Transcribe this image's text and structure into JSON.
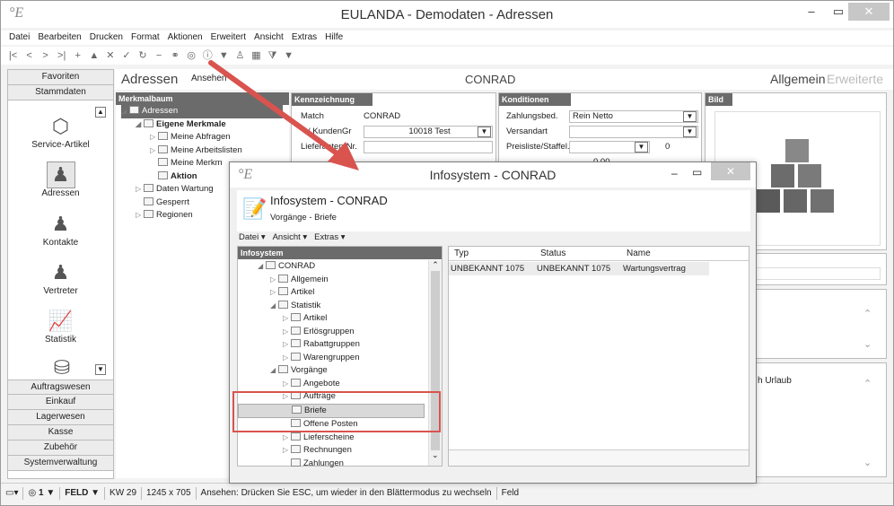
{
  "app": {
    "logo": "°E",
    "title": "EULANDA - Demodaten - Adressen",
    "minimize": "–",
    "maximize": "▭",
    "close": "✕"
  },
  "menu": [
    "Datei",
    "Bearbeiten",
    "Drucken",
    "Format",
    "Aktionen",
    "Erweitert",
    "Ansicht",
    "Extras",
    "Hilfe"
  ],
  "sidebar": {
    "top_tabs": [
      "Favoriten",
      "Stammdaten"
    ],
    "items": [
      {
        "label": "Service-Artikel",
        "icon": "cube-icon"
      },
      {
        "label": "Adressen",
        "icon": "person-icon"
      },
      {
        "label": "Kontakte",
        "icon": "contact-icon"
      },
      {
        "label": "Vertreter",
        "icon": "rep-icon"
      },
      {
        "label": "Statistik",
        "icon": "chart-icon"
      }
    ],
    "bottom_tabs": [
      "Auftragswesen",
      "Einkauf",
      "Lagerwesen",
      "Kasse",
      "Zubehör",
      "Systemverwaltung"
    ]
  },
  "header": {
    "section": "Adressen",
    "view": "Ansehen",
    "record": "CONRAD",
    "tab_active": "Allgemein",
    "tab_inactive": "Erweiterte"
  },
  "merkmalbaum": {
    "title": "Merkmalbaum",
    "items": [
      {
        "label": "Adressen",
        "level": 0,
        "selected": true
      },
      {
        "label": "Eigene Merkmale",
        "level": 1,
        "bold": true
      },
      {
        "label": "Meine Abfragen",
        "level": 2
      },
      {
        "label": "Meine Arbeitslisten",
        "level": 2
      },
      {
        "label": "Meine Merkm",
        "level": 2
      },
      {
        "label": "Aktion",
        "level": 2,
        "bold": true
      },
      {
        "label": "Daten Wartung",
        "level": 1
      },
      {
        "label": "Gesperrt",
        "level": 1
      },
      {
        "label": "Regionen",
        "level": 1
      }
    ]
  },
  "kennzeichnung": {
    "title": "Kennzeichnung",
    "match_label": "Match",
    "match_value": "CONRAD",
    "kunden_label": "/ KundenGr",
    "kunden_value": "10018 Test",
    "liefer_label": "Lieferanten-Nr.",
    "liefer_value": ""
  },
  "konditionen": {
    "title": "Konditionen",
    "zahlung_label": "Zahlungsbed.",
    "zahlung_value": "Rein Netto",
    "versand_label": "Versandart",
    "versand_value": "",
    "preis_label": "Preisliste/Staffel.",
    "preis_value": "0",
    "extra_value": "0,00"
  },
  "bild": {
    "title": "Bild"
  },
  "notes": {
    "urlaub": "h Urlaub"
  },
  "status_bar": [
    "1",
    "FELD",
    "KW 29",
    "1245 x 705",
    "Ansehen: Drücken Sie ESC, um wieder in den Blättermodus zu wechseln",
    "Feld"
  ],
  "dialog": {
    "logo": "°E",
    "title": "Infosystem - CONRAD",
    "heading": "Infosystem - CONRAD",
    "subheading": "Vorgänge - Briefe",
    "menu": [
      "Datei ▾",
      "Ansicht ▾",
      "Extras ▾"
    ],
    "tree_title": "Infosystem",
    "tree": [
      {
        "label": "CONRAD",
        "level": 0,
        "exp": "◢"
      },
      {
        "label": "Allgemein",
        "level": 1,
        "exp": "▷"
      },
      {
        "label": "Artikel",
        "level": 1,
        "exp": "▷"
      },
      {
        "label": "Statistik",
        "level": 1,
        "exp": "◢"
      },
      {
        "label": "Artikel",
        "level": 2,
        "exp": "▷"
      },
      {
        "label": "Erlösgruppen",
        "level": 2,
        "exp": "▷"
      },
      {
        "label": "Rabattgruppen",
        "level": 2,
        "exp": "▷"
      },
      {
        "label": "Warengruppen",
        "level": 2,
        "exp": "▷"
      },
      {
        "label": "Vorgänge",
        "level": 1,
        "exp": "◢"
      },
      {
        "label": "Angebote",
        "level": 2,
        "exp": "▷"
      },
      {
        "label": "Aufträge",
        "level": 2,
        "exp": "▷"
      },
      {
        "label": "Briefe",
        "level": 2,
        "exp": "",
        "selected": true
      },
      {
        "label": "Offene Posten",
        "level": 2,
        "exp": ""
      },
      {
        "label": "Lieferscheine",
        "level": 2,
        "exp": "▷"
      },
      {
        "label": "Rechnungen",
        "level": 2,
        "exp": "▷"
      },
      {
        "label": "Zahlungen",
        "level": 2,
        "exp": ""
      }
    ],
    "columns": [
      "Typ",
      "Status",
      "Name"
    ],
    "rows": [
      [
        "UNBEKANNT 1075",
        "UNBEKANNT 1075",
        "Wartungsvertrag"
      ]
    ]
  }
}
